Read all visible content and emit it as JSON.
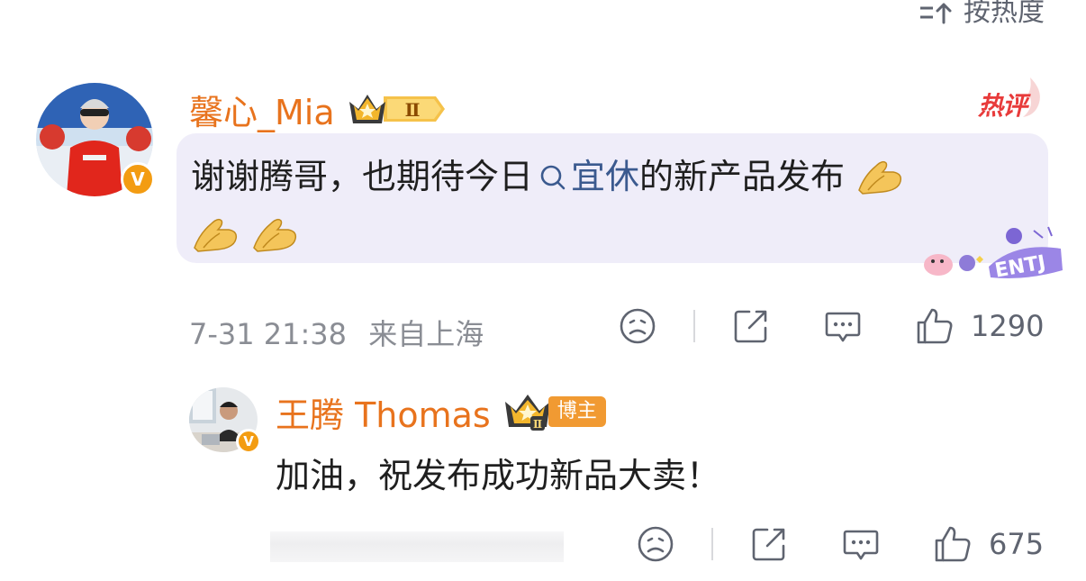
{
  "sort": {
    "icon": "sort-icon",
    "label": "按热度"
  },
  "comment": {
    "username": "馨心_Mia",
    "level_badge": "Ⅱ",
    "hot_badge": "热评",
    "text_before_topic": "谢谢腾哥，也期待今日",
    "topic": "宜休",
    "text_after_topic": "的新产品发布",
    "decoration_label": "ENTJ",
    "timestamp": "7-31 21:38",
    "location": "来自上海",
    "like_count": "1290",
    "icons": [
      "frown-icon",
      "share-icon",
      "comment-icon",
      "thumbs-up-icon"
    ],
    "colors": {
      "username": "#e8731d",
      "bubble": "#efedf9",
      "topic": "#3b5a8f",
      "hot": "#e83b3b"
    }
  },
  "reply": {
    "username": "王腾 Thomas",
    "level_badge": "Ⅱ",
    "role_badge": "博主",
    "text": "加油，祝发布成功新品大卖！",
    "like_count": "675",
    "icons": [
      "frown-icon",
      "share-icon",
      "comment-icon",
      "thumbs-up-icon"
    ]
  }
}
